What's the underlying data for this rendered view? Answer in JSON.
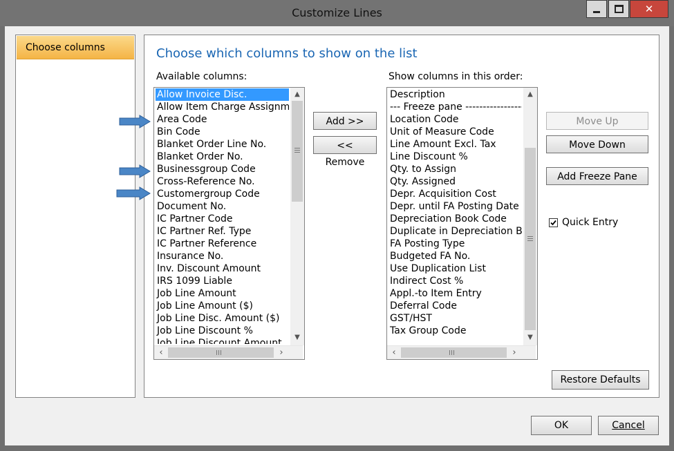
{
  "window": {
    "title": "Customize Lines"
  },
  "nav": {
    "items": [
      {
        "label": "Choose columns"
      }
    ]
  },
  "panel": {
    "heading": "Choose which columns to show on the list",
    "available_label": "Available columns:",
    "show_label": "Show columns in this order:"
  },
  "available_columns": [
    "Allow Invoice Disc.",
    "Allow Item Charge Assignment",
    "Area Code",
    "Bin Code",
    "Blanket Order Line No.",
    "Blanket Order No.",
    "Businessgroup Code",
    "Cross-Reference No.",
    "Customergroup Code",
    "Document No.",
    "IC Partner Code",
    "IC Partner Ref. Type",
    "IC Partner Reference",
    "Insurance No.",
    "Inv. Discount Amount",
    "IRS 1099 Liable",
    "Job Line Amount",
    "Job Line Amount ($)",
    "Job Line Disc. Amount ($)",
    "Job Line Discount %",
    "Job Line Discount Amount"
  ],
  "selected_available": 0,
  "shown_columns": [
    "Description",
    "--- Freeze pane -----------------",
    "Location Code",
    "Unit of Measure Code",
    "Line Amount Excl. Tax",
    "Line Discount %",
    "Qty. to Assign",
    "Qty. Assigned",
    "Depr. Acquisition Cost",
    "Depr. until FA Posting Date",
    "Depreciation Book Code",
    "Duplicate in Depreciation Book",
    "FA Posting Type",
    "Budgeted FA No.",
    "Use Duplication List",
    "Indirect Cost %",
    "Appl.-to Item Entry",
    "Deferral Code",
    "GST/HST",
    "Tax Group Code"
  ],
  "buttons": {
    "add": "Add >>",
    "remove": "<< Remove",
    "move_up": "Move Up",
    "move_down": "Move Down",
    "add_freeze_pane": "Add Freeze Pane",
    "restore_defaults": "Restore Defaults",
    "ok": "OK",
    "cancel": "Cancel"
  },
  "quick_entry": {
    "label": "Quick Entry",
    "checked": true
  },
  "icons": {
    "minimize": "minimize-icon",
    "maximize": "maximize-icon",
    "close": "close-icon",
    "annotation_arrow": "arrow-right-icon"
  },
  "colors": {
    "heading": "#1a66b3",
    "selection": "#3399ff",
    "nav_selected": "#f4b446",
    "annotation_arrow": "#4a86c6",
    "close_button": "#c7463c"
  }
}
